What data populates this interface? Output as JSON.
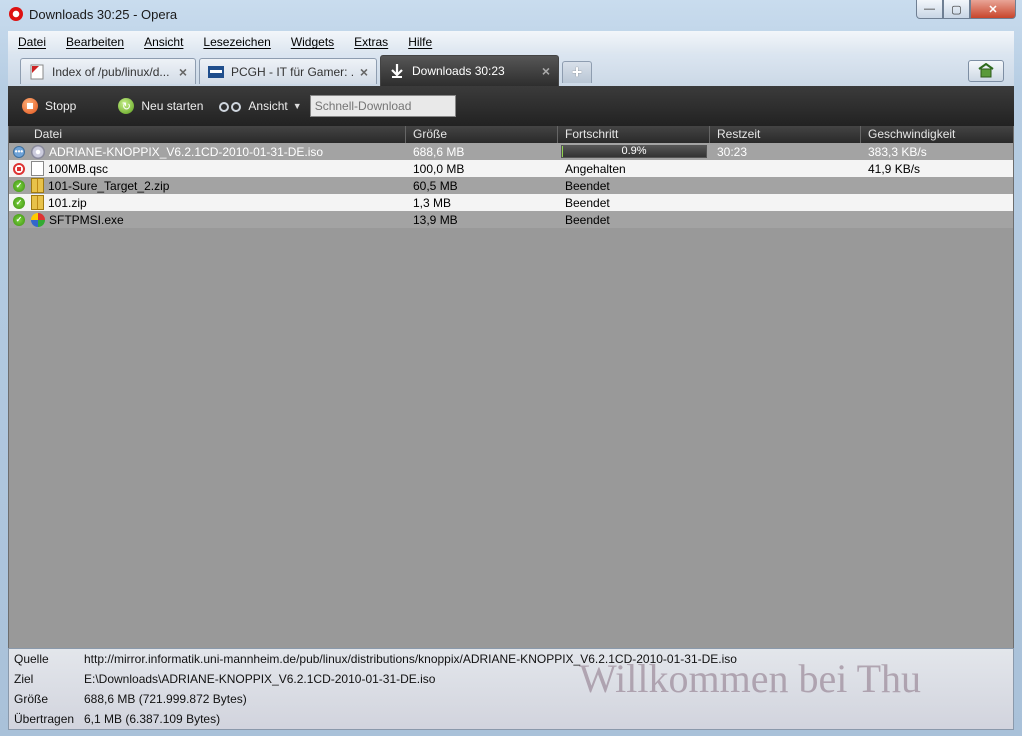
{
  "window": {
    "title": "Downloads 30:25 - Opera",
    "controls": {
      "minimize": "—",
      "maximize": "▢",
      "close": "✕"
    }
  },
  "menu": [
    "Datei",
    "Bearbeiten",
    "Ansicht",
    "Lesezeichen",
    "Widgets",
    "Extras",
    "Hilfe"
  ],
  "tabs": [
    {
      "label": "Index of /pub/linux/d...",
      "icon": "pdf-page-icon"
    },
    {
      "label": "PCGH - IT für Gamer: ...",
      "icon": "pcgh-favicon"
    },
    {
      "label": "Downloads 30:23",
      "icon": "download-arrow-icon",
      "active": true
    }
  ],
  "newtab_glyph": "+",
  "toolbar": {
    "stop": "Stopp",
    "restart": "Neu starten",
    "view": "Ansicht",
    "quick_placeholder": "Schnell-Download"
  },
  "columns": {
    "name": "Datei",
    "size": "Größe",
    "progress": "Fortschritt",
    "remaining": "Restzeit",
    "speed": "Geschwindigkeit"
  },
  "downloads": [
    {
      "name": "ADRIANE-KNOPPIX_V6.2.1CD-2010-01-31-DE.iso",
      "size": "688,6 MB",
      "progress_text": "0.9%",
      "progress_fraction": 0.009,
      "remaining": "30:23",
      "speed": "383,3 KB/s",
      "status": "active",
      "file": "iso"
    },
    {
      "name": "100MB.qsc",
      "size": "100,0 MB",
      "progress_text": "Angehalten",
      "remaining": "",
      "speed": "41,9 KB/s",
      "status": "stopped",
      "file": "blank"
    },
    {
      "name": "101-Sure_Target_2.zip",
      "size": "60,5 MB",
      "progress_text": "Beendet",
      "remaining": "",
      "speed": "",
      "status": "done",
      "file": "zip"
    },
    {
      "name": "101.zip",
      "size": "1,3 MB",
      "progress_text": "Beendet",
      "remaining": "",
      "speed": "",
      "status": "done",
      "file": "zip"
    },
    {
      "name": "SFTPMSI.exe",
      "size": "13,9 MB",
      "progress_text": "Beendet",
      "remaining": "",
      "speed": "",
      "status": "done",
      "file": "exe"
    }
  ],
  "details": {
    "source_label": "Quelle",
    "source": "http://mirror.informatik.uni-mannheim.de/pub/linux/distributions/knoppix/ADRIANE-KNOPPIX_V6.2.1CD-2010-01-31-DE.iso",
    "target_label": "Ziel",
    "target": "E:\\Downloads\\ADRIANE-KNOPPIX_V6.2.1CD-2010-01-31-DE.iso",
    "size_label": "Größe",
    "size": "688,6 MB (721.999.872 Bytes)",
    "transferred_label": "Übertragen",
    "transferred": "6,1 MB (6.387.109 Bytes)",
    "watermark": "Willkommen bei Thu"
  }
}
